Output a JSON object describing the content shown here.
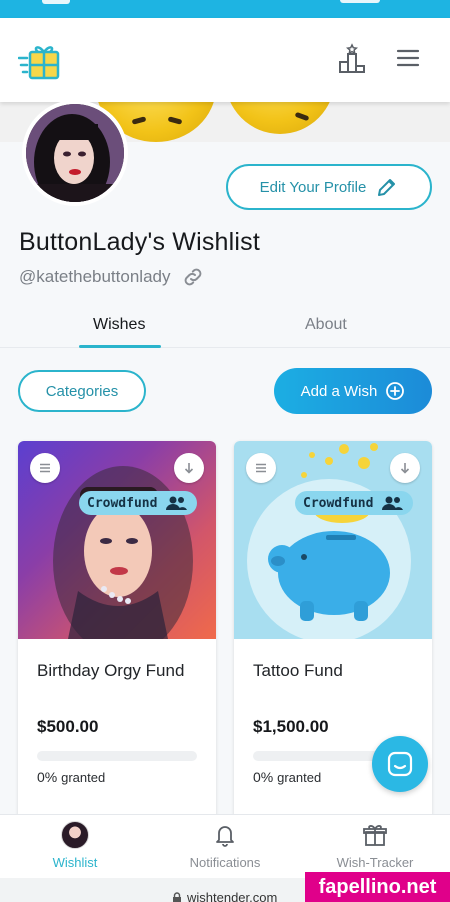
{
  "header": {
    "logo_icon": "gift-box-logo-icon",
    "leaderboard_icon": "podium-icon",
    "menu_icon": "hamburger-menu-icon"
  },
  "profile": {
    "edit_label": "Edit Your Profile",
    "edit_icon": "pencil-icon",
    "name": "ButtonLady's Wishlist",
    "handle": "@katethebuttonlady",
    "link_icon": "link-icon"
  },
  "tabs": [
    {
      "label": "Wishes",
      "active": true
    },
    {
      "label": "About",
      "active": false
    }
  ],
  "actions": {
    "categories_label": "Categories",
    "add_wish_label": "Add a Wish"
  },
  "wishes": [
    {
      "title": "Birthday Orgy Fund",
      "price": "$500.00",
      "badge": "Crowdfund",
      "granted_pct": "0%",
      "granted_label": "granted",
      "progress": 0
    },
    {
      "title": "Tattoo Fund",
      "price": "$1,500.00",
      "badge": "Crowdfund",
      "granted_pct": "0%",
      "granted_label": "granted",
      "progress": 0
    }
  ],
  "nav": {
    "wishlist": "Wishlist",
    "notifications": "Notifications",
    "tracker": "Wish-Tracker"
  },
  "browser": {
    "url": "wishtender.com"
  },
  "watermark": "fapellino.net",
  "colors": {
    "accent": "#2bb4cc",
    "status_bar": "#1eb4e2",
    "watermark": "#e0008a"
  }
}
